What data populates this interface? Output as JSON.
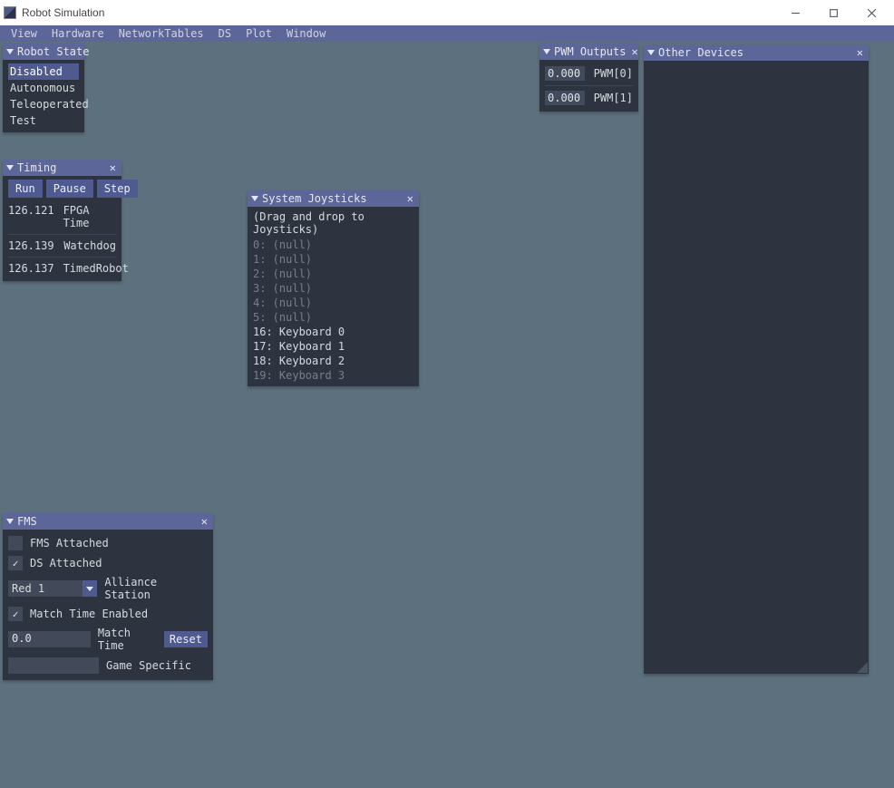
{
  "window": {
    "title": "Robot Simulation"
  },
  "menu": {
    "items": [
      "View",
      "Hardware",
      "NetworkTables",
      "DS",
      "Plot",
      "Window"
    ]
  },
  "robot_state": {
    "title": "Robot State",
    "items": [
      "Disabled",
      "Autonomous",
      "Teleoperated",
      "Test"
    ],
    "selected": "Disabled"
  },
  "timing": {
    "title": "Timing",
    "buttons": {
      "run": "Run",
      "pause": "Pause",
      "step": "Step"
    },
    "rows": [
      {
        "value": "126.121",
        "label": "FPGA Time"
      },
      {
        "value": "126.139",
        "label": "Watchdog"
      },
      {
        "value": "126.137",
        "label": "TimedRobot"
      }
    ]
  },
  "system_joysticks": {
    "title": "System Joysticks",
    "hint": "(Drag and drop to Joysticks)",
    "items": [
      {
        "text": "0: (null)",
        "dim": true
      },
      {
        "text": "1: (null)",
        "dim": true
      },
      {
        "text": "2: (null)",
        "dim": true
      },
      {
        "text": "3: (null)",
        "dim": true
      },
      {
        "text": "4: (null)",
        "dim": true
      },
      {
        "text": "5: (null)",
        "dim": true
      },
      {
        "text": "16: Keyboard 0",
        "dim": false
      },
      {
        "text": "17: Keyboard 1",
        "dim": false
      },
      {
        "text": "18: Keyboard 2",
        "dim": false
      },
      {
        "text": "19: Keyboard 3",
        "dim": true
      }
    ]
  },
  "pwm_outputs": {
    "title": "PWM Outputs",
    "rows": [
      {
        "value": "0.000",
        "label": "PWM[0]"
      },
      {
        "value": "0.000",
        "label": "PWM[1]"
      }
    ]
  },
  "other_devices": {
    "title": "Other Devices"
  },
  "fms": {
    "title": "FMS",
    "fms_attached": {
      "label": "FMS Attached",
      "checked": false
    },
    "ds_attached": {
      "label": "DS Attached",
      "checked": true
    },
    "alliance_station": {
      "label": "Alliance Station",
      "value": "Red 1"
    },
    "match_time_enabled": {
      "label": "Match Time Enabled",
      "checked": true
    },
    "match_time": {
      "label": "Match Time",
      "value": "0.0",
      "reset": "Reset"
    },
    "game_specific": {
      "label": "Game Specific",
      "value": ""
    }
  }
}
